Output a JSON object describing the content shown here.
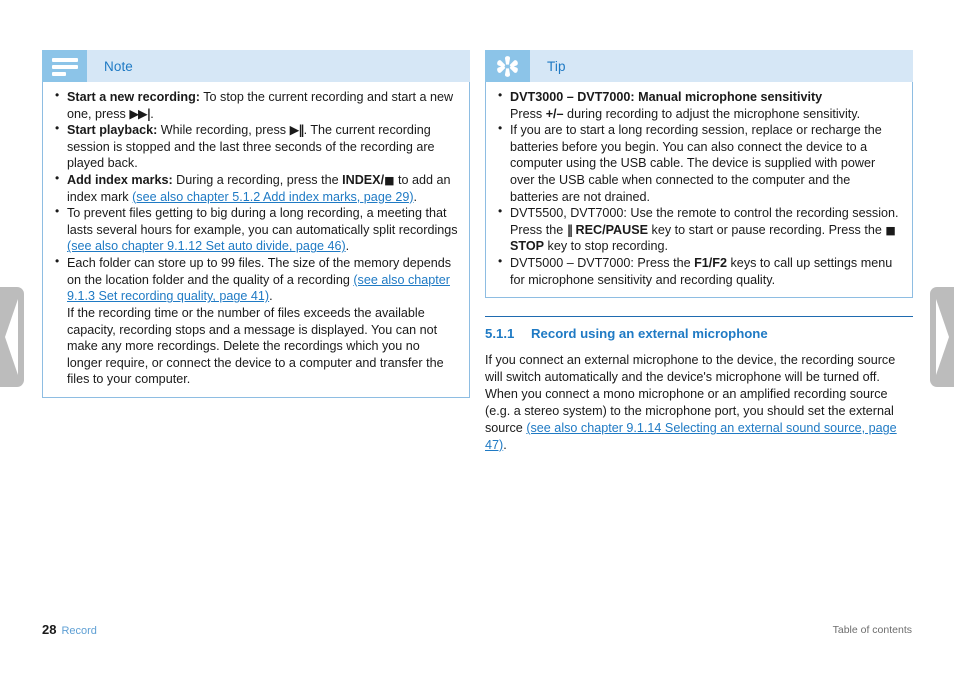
{
  "page": {
    "number": "28",
    "section_label": "Record",
    "footer_right": "Table of contents"
  },
  "nav": {
    "prev_label": "Previous page",
    "next_label": "Next page"
  },
  "note_box": {
    "icon": "note-lines-icon",
    "title": "Note",
    "accent": "#8cc4e8",
    "header_bg": "#d6e7f6",
    "border": "#8ebde2",
    "items": [
      {
        "lead": "Start a new recording:",
        "text_a": " To stop the current recording and start a new one, press ",
        "symbol": "▶▶|",
        "text_b": "."
      },
      {
        "lead": "Start playback:",
        "text_a": " While recording, press ",
        "symbol": "▶‖",
        "text_b": ". The current recording session is stopped and the last three seconds of the recording are played back."
      },
      {
        "lead": "Add index marks:",
        "text_a": " During a recording, press the ",
        "bold_key": "INDEX/",
        "symbol": "■",
        "text_b": " to add an index mark ",
        "link": "(see also chapter 5.1.2 Add index marks, page 29)",
        "text_c": "."
      },
      {
        "text_a": "To prevent files getting to big during a long recording, a meeting that lasts several hours for example, you can automatically split recordings ",
        "link": "(see also chapter 9.1.12 Set auto divide, page 46)",
        "text_c": "."
      },
      {
        "text_a": "Each folder can store up to 99 files. The size of the memory depends on the location folder and the quality of a recording ",
        "link": "(see also chapter 9.1.3 Set recording quality, page 41)",
        "text_c": ".",
        "text_d": "If the recording time or the number of files exceeds the available capacity, recording stops and a message is displayed. You can not make any more recordings. Delete the recordings which you no longer require, or connect the device to a computer and transfer the files to your computer."
      }
    ]
  },
  "tip_box": {
    "icon": "asterisk-icon",
    "title": "Tip",
    "accent": "#8cc4e8",
    "header_bg": "#d6e7f6",
    "border": "#8ebde2",
    "items": [
      {
        "lead": "DVT3000 – DVT7000: Manual microphone sensitivity",
        "text_a": "Press ",
        "bold_key": "+/–",
        "text_b": " during recording to adjust the microphone sensitivity."
      },
      {
        "text_a": "If you are to start a long recording session, replace or recharge the batteries before you begin. You can also connect the device to a computer using the USB cable. The device is supplied with power over the USB cable when connected to the computer and the batteries are not drained."
      },
      {
        "text_a": "DVT5500, DVT7000: Use the remote to control the recording session. Press the ",
        "symbol1": "‖",
        "bold_key1": " REC/PAUSE",
        "text_b": " key to start or pause recording. Press the ",
        "symbol2": "■",
        "bold_key2": " STOP",
        "text_c": " key to stop recording."
      },
      {
        "text_a": "DVT5000 – DVT7000: Press the ",
        "bold_key1": "F1/F2",
        "text_b": " keys to call up settings menu for microphone sensitivity and recording quality."
      }
    ]
  },
  "section": {
    "number": "5.1.1",
    "title": "Record using an external microphone",
    "accent": "#1f7ac4",
    "paragraph": {
      "text_a": "If you connect an external microphone to the device, the recording source will switch automatically and the device's microphone will be turned off. When you connect a mono microphone or an amplified recording source (e.g. a stereo system) to the microphone port, you should set the external source ",
      "link": "(see also chapter 9.1.14 Selecting an external sound source, page 47)",
      "text_b": "."
    }
  }
}
